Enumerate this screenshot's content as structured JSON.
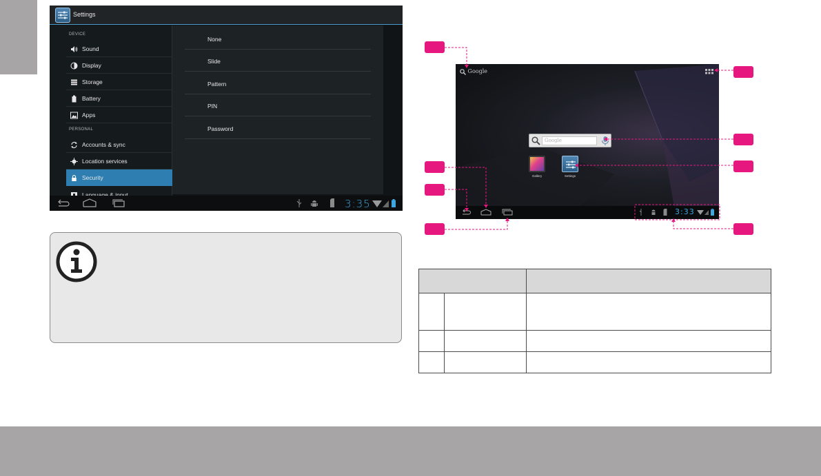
{
  "settings_screen": {
    "title": "Settings",
    "sections": [
      "DEVICE",
      "PERSONAL"
    ],
    "items": [
      {
        "label": "Sound",
        "icon": "speaker-icon"
      },
      {
        "label": "Display",
        "icon": "display-icon"
      },
      {
        "label": "Storage",
        "icon": "storage-icon"
      },
      {
        "label": "Battery",
        "icon": "battery-icon"
      },
      {
        "label": "Apps",
        "icon": "apps-icon"
      },
      {
        "label": "Accounts & sync",
        "icon": "sync-icon"
      },
      {
        "label": "Location services",
        "icon": "location-icon"
      },
      {
        "label": "Security",
        "icon": "lock-icon",
        "active": true
      },
      {
        "label": "Language & input",
        "icon": "keyboard-icon"
      }
    ],
    "lock_options": [
      "None",
      "Slide",
      "Pattern",
      "PIN",
      "Password"
    ],
    "clock": "3:35",
    "accent_color": "#2f7eb2"
  },
  "home_screen": {
    "search_label": "Google",
    "search_placeholder": "Google",
    "apps": [
      {
        "label": "Gallery",
        "icon": "gallery-icon"
      },
      {
        "label": "Settings",
        "icon": "settings-icon"
      }
    ],
    "clock": "3:33",
    "callout_color": "#e6177f"
  },
  "colors": {
    "band_gray": "#a7a5a6",
    "note_background": "#e8e8e8",
    "clock_blue": "#3fa7e0"
  }
}
